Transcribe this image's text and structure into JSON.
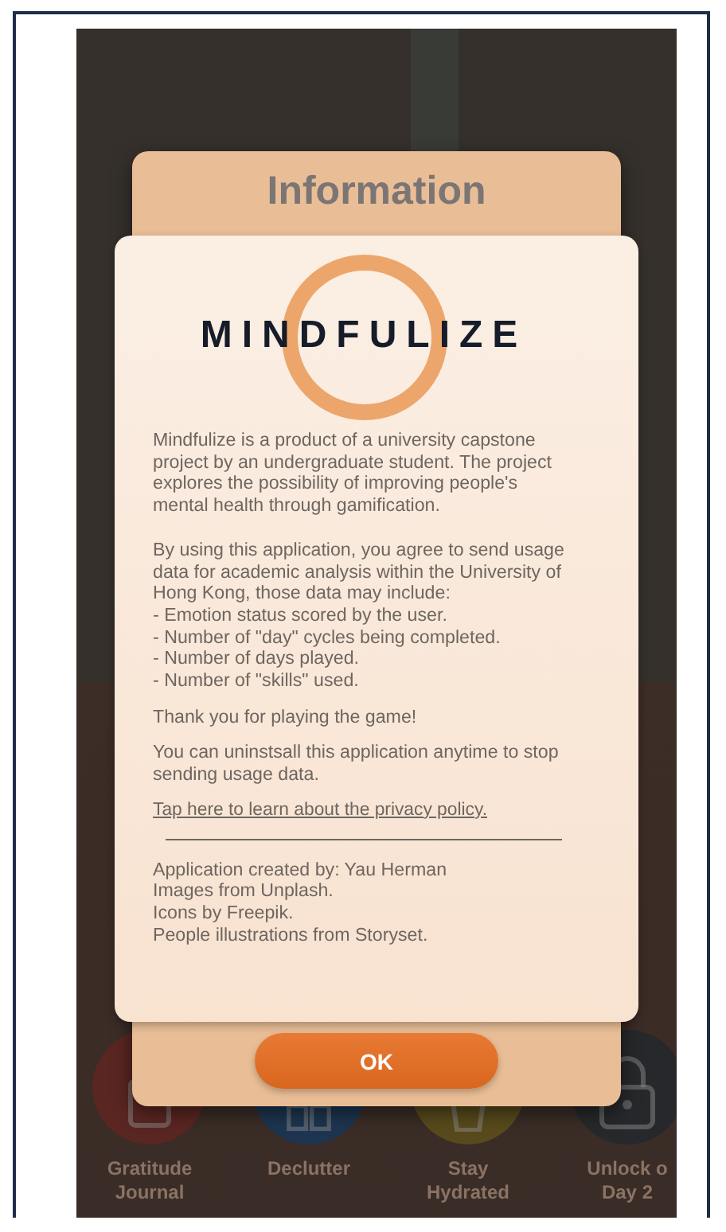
{
  "dialog": {
    "title": "Information",
    "logo": "MINDFULIZE",
    "intro": "Mindfulize is a product of a university capstone project by an undergraduate student. The project explores the possibility of improving people's mental health through gamification.",
    "consent": "By using this application, you agree to send usage data for academic analysis within the University of Hong Kong, those data may include:",
    "data_items": [
      "- Emotion status scored by the user.",
      "- Number of \"day\" cycles being completed.",
      "- Number of days played.",
      "- Number of \"skills\" used."
    ],
    "thanks": "Thank you for playing the game!",
    "uninstall": "You can uninstsall this application anytime to stop sending usage data.",
    "privacy_link": "Tap here to learn about the privacy policy.",
    "credits": [
      "Application created by: Yau Herman",
      "Images from Unplash.",
      "Icons by Freepik.",
      "People illustrations from Storyset."
    ],
    "ok_button": "OK"
  },
  "skills": [
    {
      "kind": "journal",
      "label": [
        "Gratitude",
        "Journal"
      ],
      "color": "#5a2622"
    },
    {
      "kind": "declutter",
      "label": [
        "Declutter"
      ],
      "color": "#1d3550"
    },
    {
      "kind": "water",
      "label": [
        "Stay",
        "Hydrated"
      ],
      "color": "#584a1c"
    },
    {
      "kind": "locked",
      "label": [
        "Unlock o",
        "Day 2"
      ],
      "color": "#26282b"
    }
  ]
}
